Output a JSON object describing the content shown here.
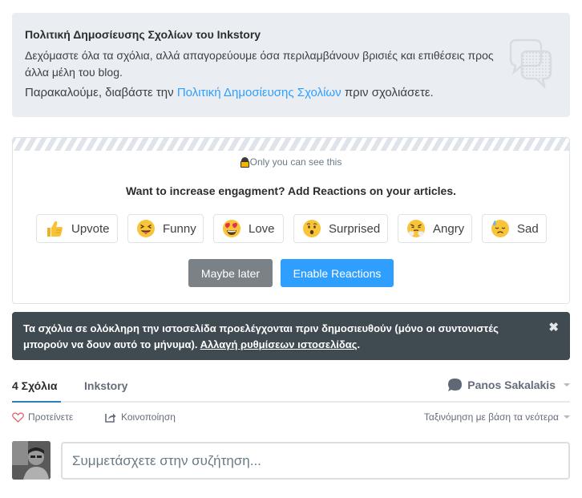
{
  "policy": {
    "title": "Πολιτική Δημοσίευσης Σχολίων του Inkstory",
    "text": "Δεχόμαστε όλα τα σχόλια, αλλά απαγορεύουμε όσα περιλαμβάνουν βρισιές και επιθέσεις προς άλλα μέλη του blog.",
    "read_prefix": "Παρακαλούμε, διαβάστε την ",
    "read_link": "Πολιτική Δημοσίευσης Σχολίων",
    "read_suffix": " πριν σχολιάσετε."
  },
  "reactions_promo": {
    "visibility_note": "Only you can see this",
    "cta": "Want to increase engagment? Add Reactions on your articles.",
    "reactions": [
      {
        "label": "Upvote",
        "icon": "thumbs-up-emoji"
      },
      {
        "label": "Funny",
        "icon": "squinting-tongue-emoji"
      },
      {
        "label": "Love",
        "icon": "heart-eyes-emoji"
      },
      {
        "label": "Surprised",
        "icon": "hushed-face-emoji"
      },
      {
        "label": "Angry",
        "icon": "steam-nose-emoji"
      },
      {
        "label": "Sad",
        "icon": "downcast-sweat-emoji"
      }
    ],
    "maybe_later_label": "Maybe later",
    "enable_label": "Enable Reactions",
    "colors": {
      "primary": "#2e9fff",
      "secondary": "#7a8288"
    }
  },
  "moderation_alert": {
    "text": "Τα σχόλια σε ολόκληρη την ιστοσελίδα προελέγχονται πριν δημοσιευθούν (μόνο οι συντονιστές μπορούν να δουν αυτό το μήνυμα). ",
    "link": "Αλλαγή ρυθμίσεων ιστοσελίδας",
    "link_suffix": ".",
    "close_icon": "✖"
  },
  "tabs": {
    "comments_label": "4 Σχόλια",
    "site_label": "Inkstory",
    "user_name": "Panos Sakalakis"
  },
  "actions": {
    "recommend_label": "Προτείνετε",
    "share_label": "Κοινοποίηση",
    "sort_label": "Ταξινόμηση με βάση τα νεότερα"
  },
  "composer": {
    "placeholder": "Συμμετάσχετε στην συζήτηση..."
  }
}
